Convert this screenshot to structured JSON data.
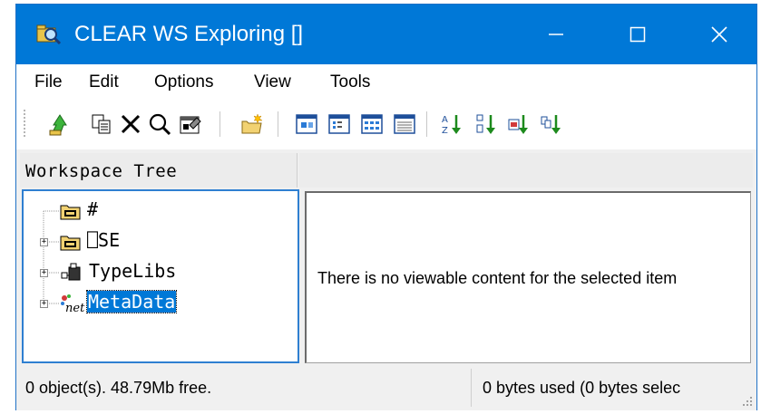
{
  "window": {
    "title": "CLEAR WS Exploring []",
    "title_bar_color": "#0078d7"
  },
  "menu": [
    {
      "label": "File"
    },
    {
      "label": "Edit"
    },
    {
      "label": "Options"
    },
    {
      "label": "View"
    },
    {
      "label": "Tools"
    }
  ],
  "toolbar": {
    "icons": [
      "up-arrow-icon",
      "copy-icon",
      "delete-icon",
      "find-icon",
      "properties-icon",
      "new-folder-icon",
      "large-icons-view-icon",
      "small-icons-view-icon",
      "list-view-icon",
      "details-view-icon",
      "sort-by-name-icon",
      "sort-by-type-icon",
      "sort-by-size-icon",
      "sort-by-date-icon"
    ]
  },
  "panes": {
    "left_header": "Workspace Tree"
  },
  "tree": {
    "items": [
      {
        "label": "#",
        "icon": "namespace-folder-icon",
        "expandable": false
      },
      {
        "label": "⎕SE",
        "icon": "namespace-folder-icon",
        "expandable": true
      },
      {
        "label": "TypeLibs",
        "icon": "typelib-icon",
        "expandable": true
      },
      {
        "label": "MetaData",
        "icon": "dotnet-icon",
        "expandable": true,
        "selected": true
      }
    ]
  },
  "content": {
    "message": "There is no viewable content for the selected item"
  },
  "status": {
    "left": "0 object(s). 48.79Mb free.",
    "right": "0 bytes used (0 bytes selec"
  }
}
